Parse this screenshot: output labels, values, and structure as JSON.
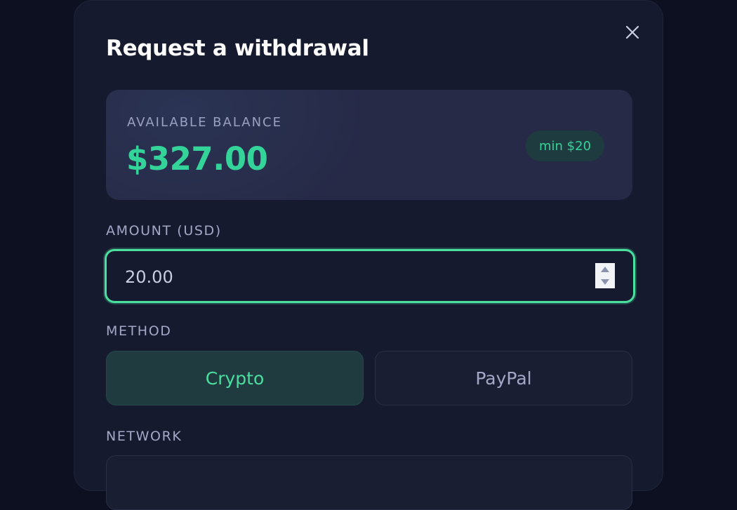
{
  "modal": {
    "title": "Request a withdrawal",
    "close_icon": "close-icon"
  },
  "balance": {
    "label": "AVAILABLE BALANCE",
    "value": "$327.00",
    "min_badge": "min $20"
  },
  "amount": {
    "label": "AMOUNT (USD)",
    "value": "20.00"
  },
  "method": {
    "label": "METHOD",
    "options": [
      {
        "label": "Crypto",
        "selected": true
      },
      {
        "label": "PayPal",
        "selected": false
      }
    ]
  },
  "network": {
    "label": "NETWORK"
  },
  "colors": {
    "accent": "#34d399",
    "focus_border": "#4ade9f",
    "modal_bg": "#161a2e",
    "page_bg": "#0d1020"
  }
}
